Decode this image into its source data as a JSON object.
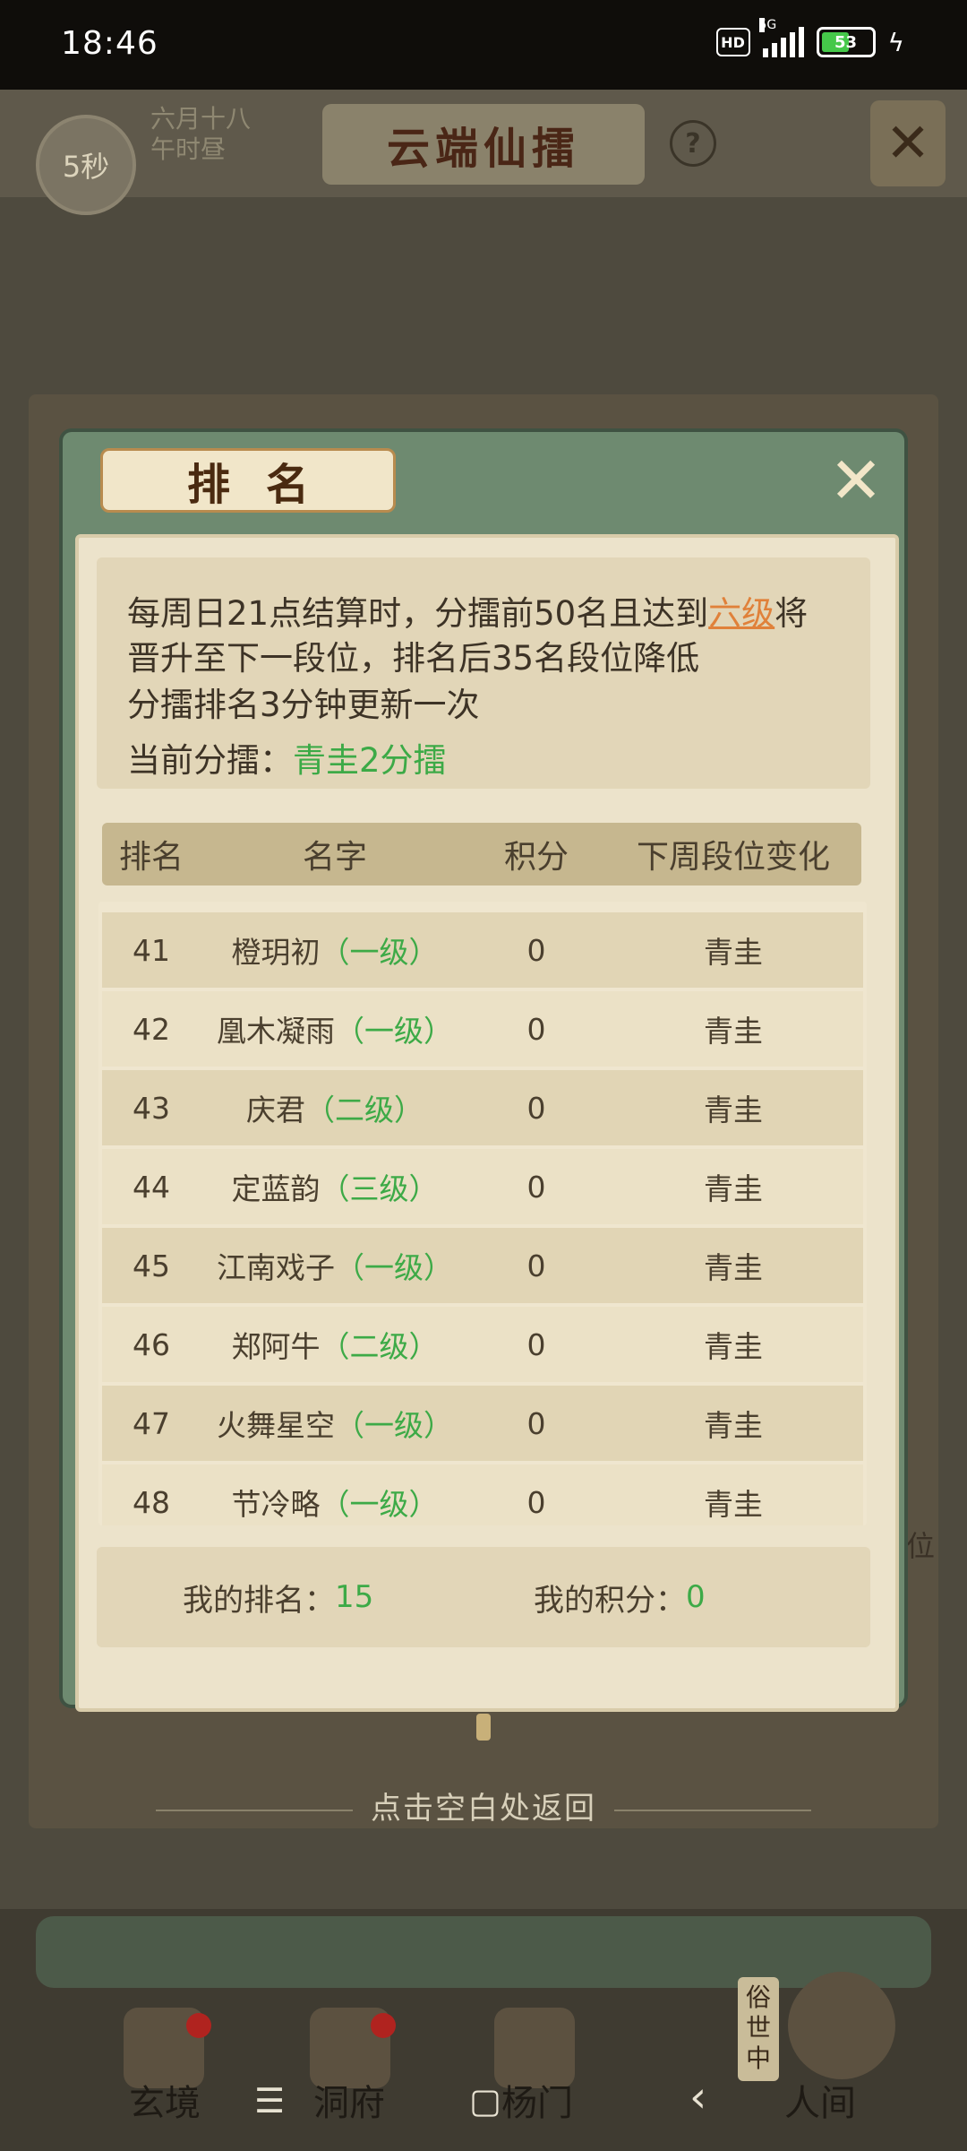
{
  "status_bar": {
    "time": "18:46",
    "hd": "HD",
    "network": "5G",
    "battery": "53",
    "icons": [
      "hd-icon",
      "signal-icon",
      "battery-icon",
      "charging-icon"
    ]
  },
  "game_header": {
    "timer": "5秒",
    "date_line1": "六月十八",
    "date_line2": "午时昼",
    "title": "云端仙擂",
    "help": "?"
  },
  "background": {
    "position_label": "位",
    "back_hint": "点击空白处返回"
  },
  "bottom_nav": {
    "items": [
      "玄境",
      "洞府",
      "杨门",
      "人间"
    ],
    "tag": "俗世中",
    "sys_menu": "☰",
    "sys_home": "▢",
    "sys_back": "‹"
  },
  "modal": {
    "title": "排名",
    "info": {
      "line1_prefix": "每周日21点结算时，分擂前50名且达到",
      "line1_link": "六级",
      "line1_suffix": "将",
      "line2": "晋升至下一段位，排名后35名段位降低",
      "line3": "分擂排名3分钟更新一次",
      "current_label": "当前分擂：",
      "current_value": "青圭2分擂"
    },
    "columns": [
      "排名",
      "名字",
      "积分",
      "下周段位变化"
    ],
    "rows": [
      {
        "rank": "41",
        "name": "橙玥初",
        "level": "（一级）",
        "score": "0",
        "change": "青圭"
      },
      {
        "rank": "42",
        "name": "凰木凝雨",
        "level": "（一级）",
        "score": "0",
        "change": "青圭"
      },
      {
        "rank": "43",
        "name": "庆君",
        "level": "（二级）",
        "score": "0",
        "change": "青圭"
      },
      {
        "rank": "44",
        "name": "定蓝韵",
        "level": "（三级）",
        "score": "0",
        "change": "青圭"
      },
      {
        "rank": "45",
        "name": "江南戏子",
        "level": "（一级）",
        "score": "0",
        "change": "青圭"
      },
      {
        "rank": "46",
        "name": "郑阿牛",
        "level": "（二级）",
        "score": "0",
        "change": "青圭"
      },
      {
        "rank": "47",
        "name": "火舞星空",
        "level": "（一级）",
        "score": "0",
        "change": "青圭"
      },
      {
        "rank": "48",
        "name": "节冷略",
        "level": "（一级）",
        "score": "0",
        "change": "青圭"
      }
    ],
    "my_rank_label": "我的排名：",
    "my_rank_value": "15",
    "my_score_label": "我的积分：",
    "my_score_value": "0"
  }
}
